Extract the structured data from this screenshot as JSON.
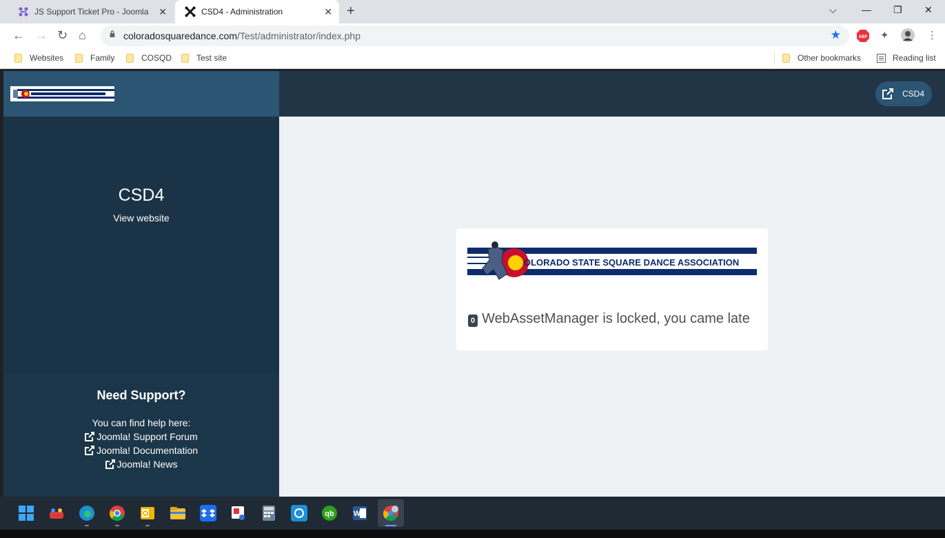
{
  "browser": {
    "tabs": [
      {
        "title": "JS Support Ticket Pro - Joomla",
        "icon": "joomla-grid-icon"
      },
      {
        "title": "CSD4 - Administration",
        "icon": "joomla-logo-icon"
      }
    ],
    "url_domain": "coloradosquaredance.com",
    "url_path": "/Test/administrator/index.php",
    "bookmarks": [
      "Websites",
      "Family",
      "COSQD",
      "Test site"
    ],
    "other_bookmarks": "Other bookmarks",
    "reading_list": "Reading list",
    "abp_label": "ABP"
  },
  "admin": {
    "site_button": "CSD4",
    "site_name": "CSD4",
    "view_website": "View website",
    "support": {
      "heading": "Need Support?",
      "intro": "You can find help here:",
      "links": [
        "Joomla! Support Forum",
        "Joomla! Documentation",
        "Joomla! News"
      ]
    },
    "logo_text": "OLORADO STATE SQUARE DANCE ASSOCIATION",
    "error_code": "0",
    "error_message": "WebAssetManager is locked, you came late"
  },
  "colors": {
    "sidebar": "#1b3346",
    "header": "#213547",
    "accent": "#2b5572",
    "logo_navy": "#0d2c6b",
    "flag_red": "#c8102e",
    "flag_gold": "#ffd100"
  }
}
